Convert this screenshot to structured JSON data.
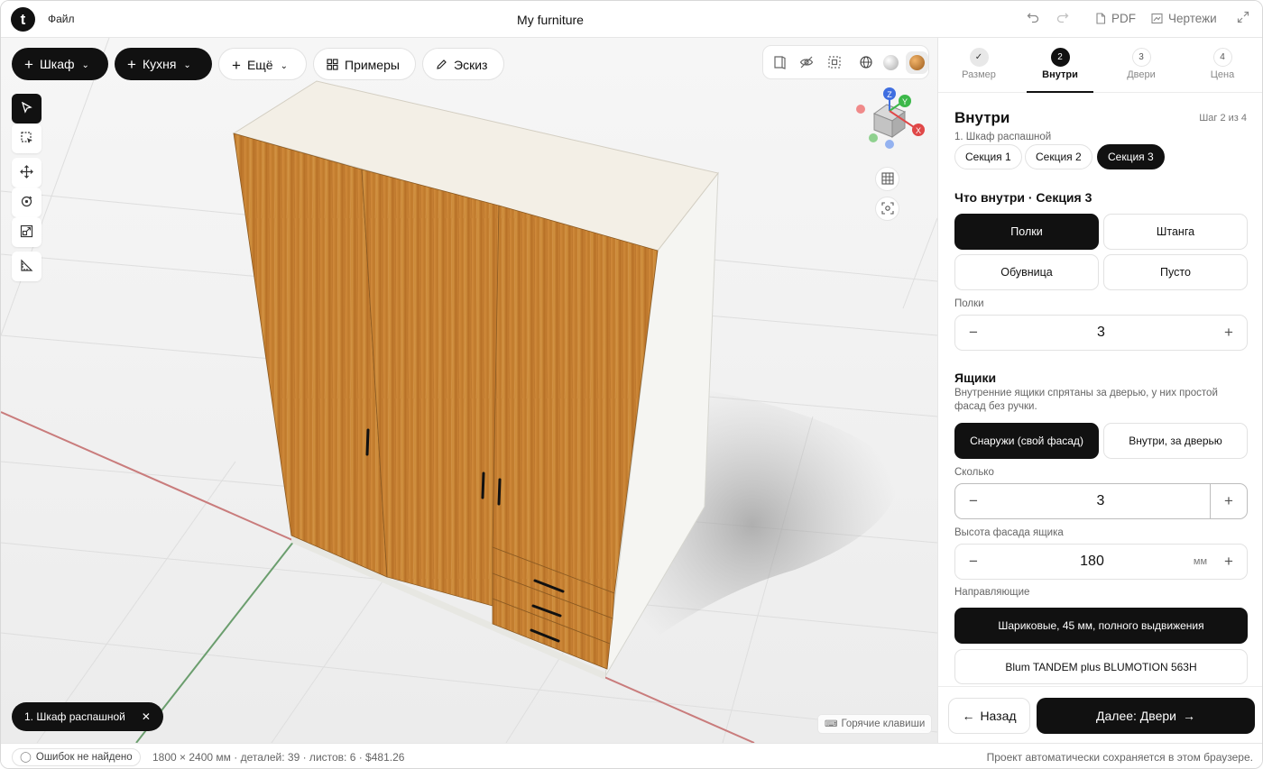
{
  "app": {
    "logo_letter": "t",
    "menu_file": "Файл",
    "title": "My furniture",
    "undo_icon": "undo-icon",
    "redo_icon": "redo-icon",
    "pdf_label": "PDF",
    "drawings_label": "Чертежи",
    "expand_icon": "expand-icon"
  },
  "toolbar": {
    "cabinet": "Шкаф",
    "kitchen": "Кухня",
    "more": "Ещё",
    "examples": "Примеры",
    "sketch": "Эскиз"
  },
  "view_tools": [
    "door-view-icon",
    "hide-icon",
    "select-area-icon",
    "wireframe-icon",
    "material-white",
    "material-wood"
  ],
  "side_tools": [
    "select-icon",
    "box-select-icon",
    "move-icon",
    "rotate-icon",
    "scale-icon",
    "measure-icon"
  ],
  "gizmo": {
    "x": "X",
    "y": "Y",
    "z": "Z"
  },
  "selection_chip": "1. Шкаф распашной",
  "hotkeys": "Горячие клавиши",
  "panel": {
    "steps": [
      {
        "num": "✓",
        "label": "Размер"
      },
      {
        "num": "2",
        "label": "Внутри"
      },
      {
        "num": "3",
        "label": "Двери"
      },
      {
        "num": "4",
        "label": "Цена"
      }
    ],
    "title": "Внутри",
    "step_info": "Шаг 2 из 4",
    "subtitle": "1. Шкаф распашной",
    "sections": [
      "Секция 1",
      "Секция 2",
      "Секция 3"
    ],
    "active_section": "Секция 3",
    "inside_heading": "Что внутри · Секция 3",
    "inside_options": [
      "Полки",
      "Штанга",
      "Обувница",
      "Пусто"
    ],
    "inside_selected": "Полки",
    "shelves_label": "Полки",
    "shelves_value": "3",
    "drawers_heading": "Ящики",
    "drawers_desc": "Внутренние ящики спрятаны за дверью, у них простой фасад без ручки.",
    "drawer_modes": [
      "Снаружи (свой фасад)",
      "Внутри, за дверью"
    ],
    "drawer_mode_selected": "Снаружи (свой фасад)",
    "count_label": "Сколько",
    "count_value": "3",
    "facade_label": "Высота фасада ящика",
    "facade_value": "180",
    "facade_unit": "мм",
    "rails_label": "Направляющие",
    "rails": [
      "Шариковые, 45 мм, полного выдвижения",
      "Blum TANDEM plus BLUMOTION 563H"
    ],
    "rails_selected": "Шариковые, 45 мм, полного выдвижения",
    "back": "Назад",
    "next": "Далее: Двери"
  },
  "status": {
    "errors": "Ошибок не найдено",
    "stats": "1800 × 2400 мм · деталей: 39 · листов: 6 · $481.26",
    "saved": "Проект автоматически сохраняется в этом браузере."
  },
  "colors": {
    "dark": "#111111",
    "wood": "#c07a2c",
    "axis_x": "#e04848",
    "axis_y": "#3cb84a",
    "axis_z": "#3f6ee0"
  }
}
